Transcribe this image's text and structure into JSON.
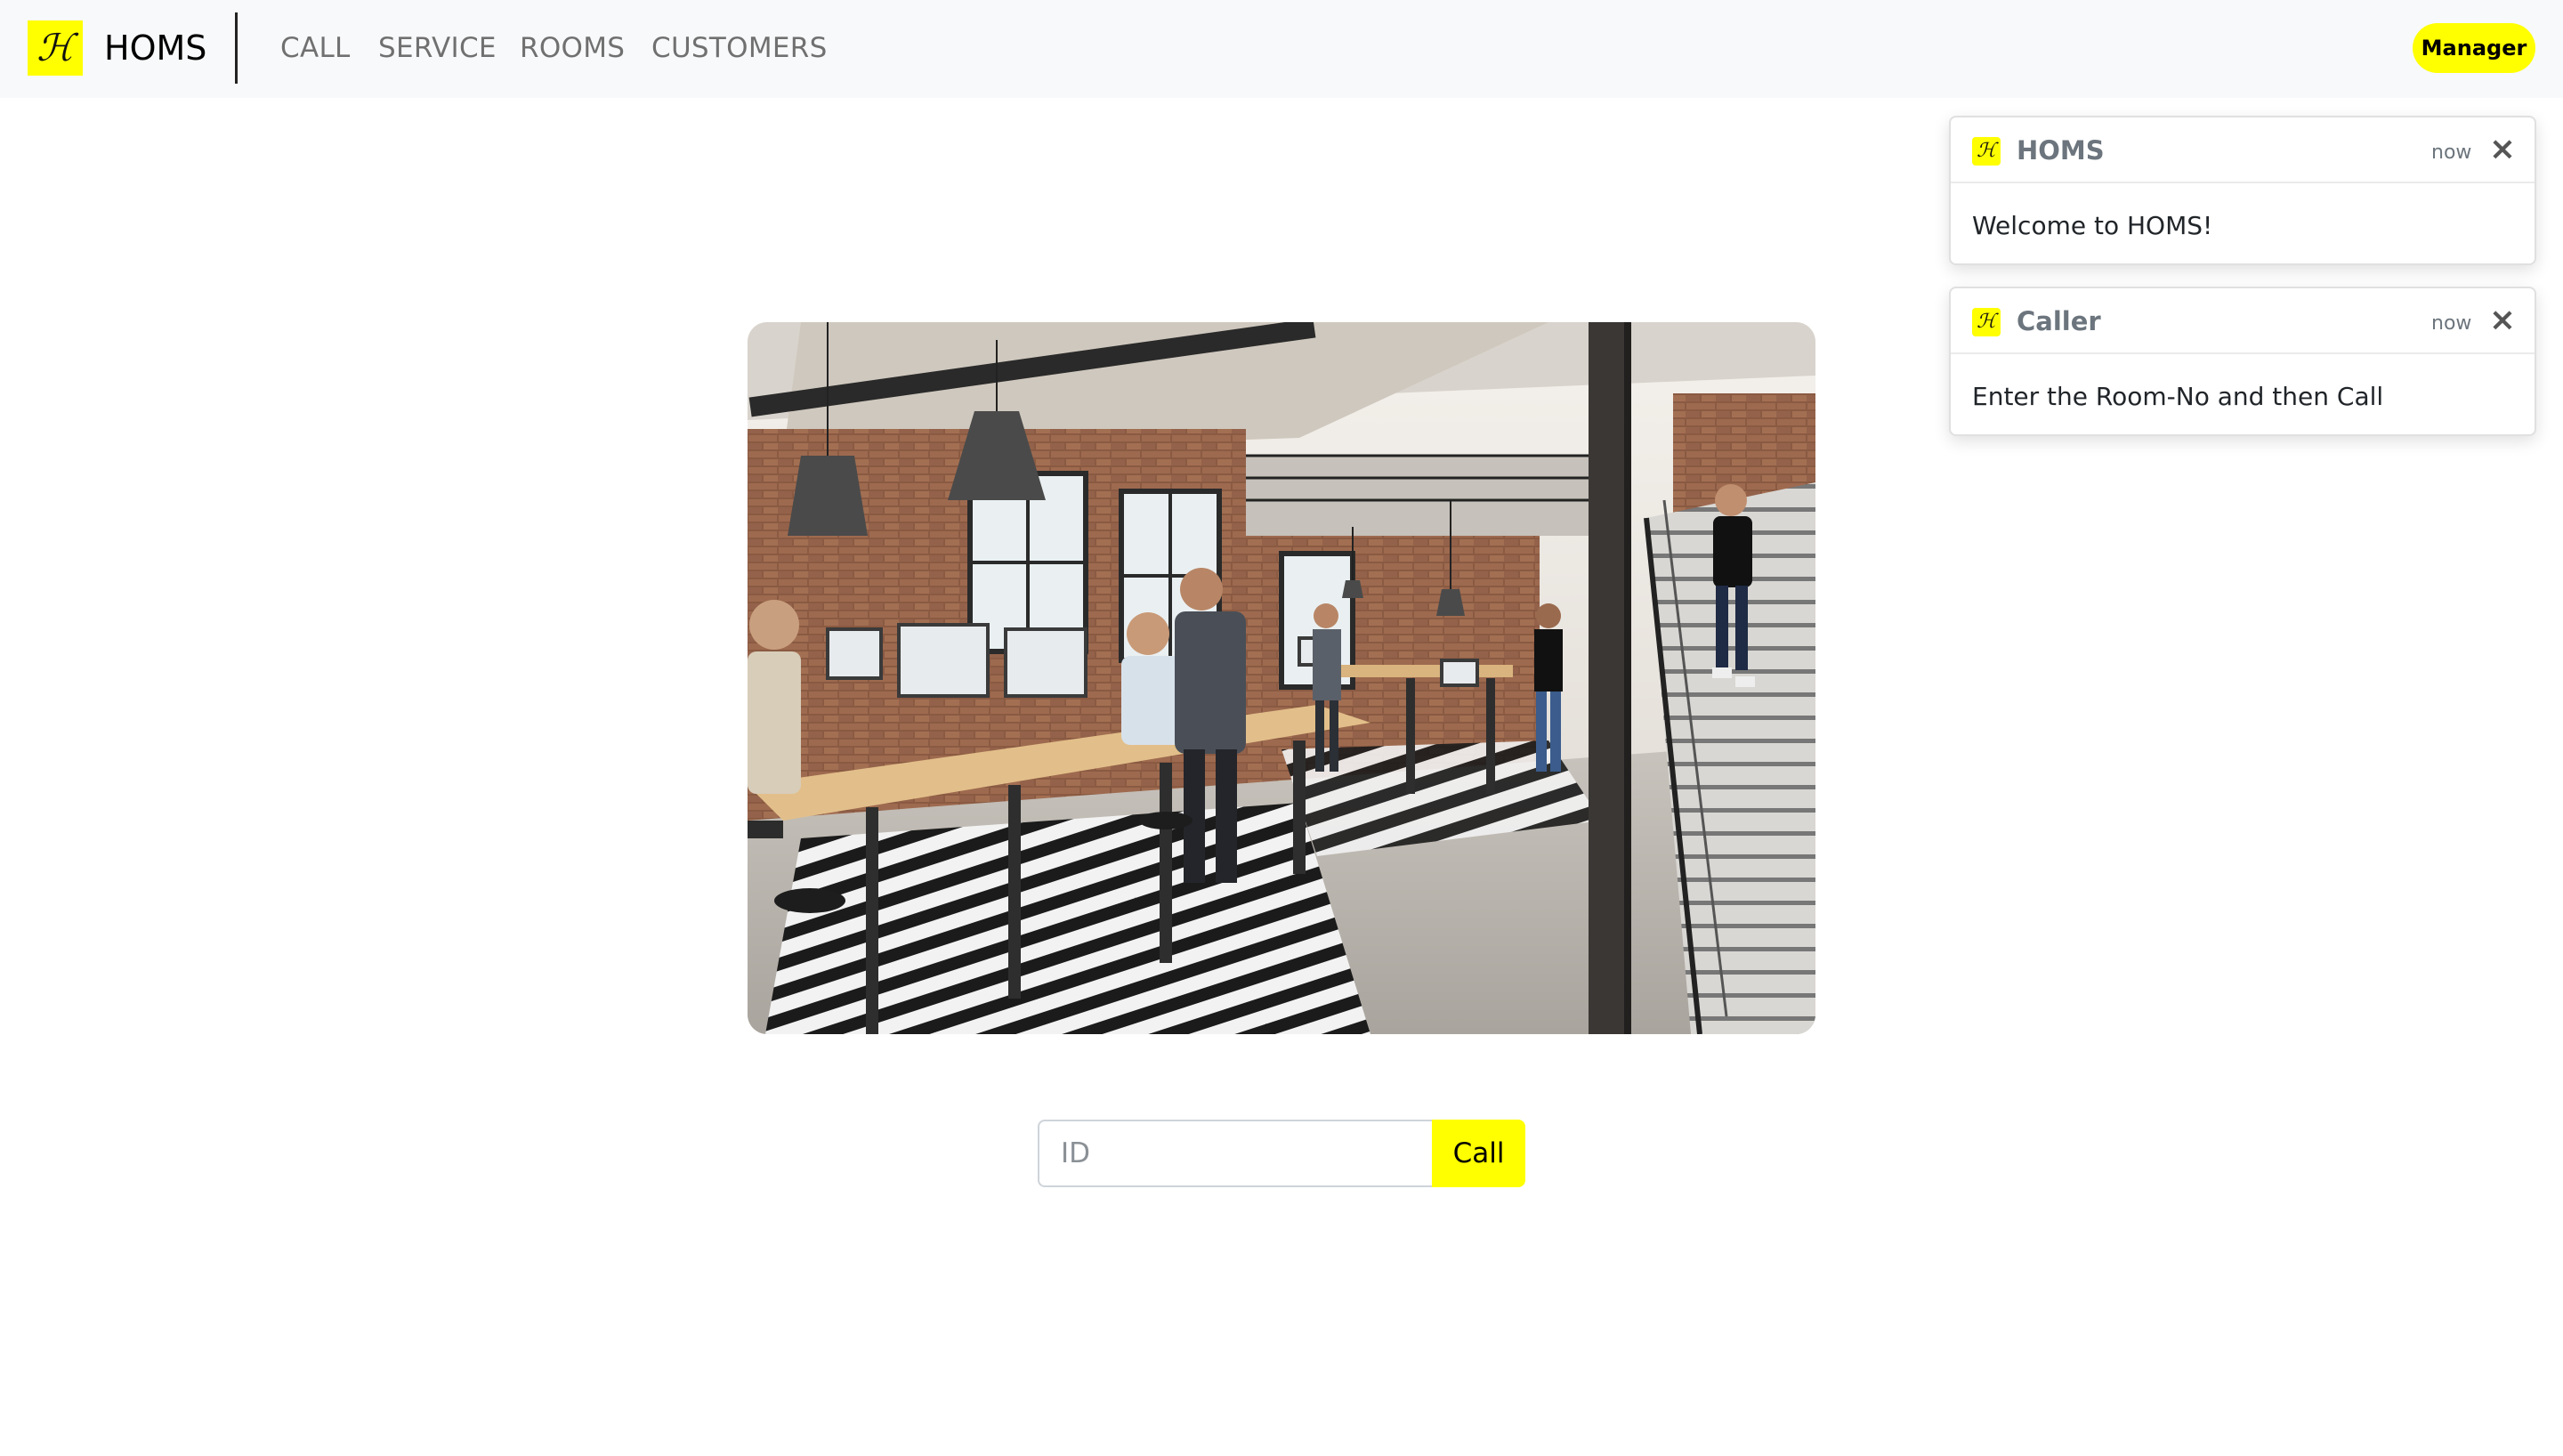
{
  "navbar": {
    "brand": {
      "logo_glyph": "ℋ",
      "name": "HOMS"
    },
    "links": [
      {
        "label": "CALL"
      },
      {
        "label": "SERVICE"
      },
      {
        "label": "ROOMS"
      },
      {
        "label": "CUSTOMERS"
      }
    ],
    "account_button": "Manager"
  },
  "toasts": [
    {
      "icon_glyph": "ℋ",
      "title": "HOMS",
      "time": "now",
      "close_icon": "×",
      "body": "Welcome to HOMS!"
    },
    {
      "icon_glyph": "ℋ",
      "title": "Caller",
      "time": "now",
      "close_icon": "×",
      "body": "Enter the Room-No and then Call"
    }
  ],
  "hero": {
    "subject": "office-interior-photo"
  },
  "call_form": {
    "id_placeholder": "ID",
    "id_value": "",
    "call_label": "Call"
  },
  "colors": {
    "accent": "#ffff00",
    "navbar_bg": "#f8f9fa",
    "nav_link": "#737373",
    "muted": "#6c757d"
  }
}
